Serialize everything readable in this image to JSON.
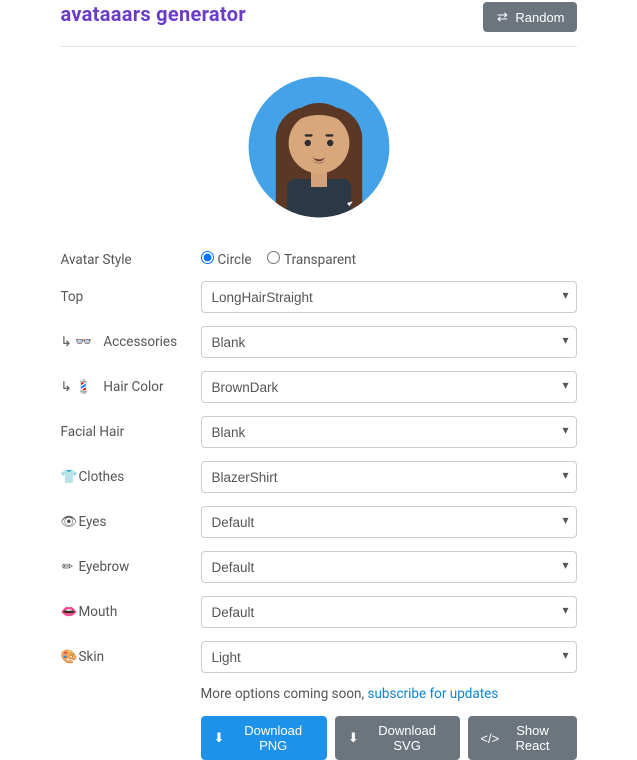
{
  "header": {
    "title": "avataaars generator",
    "random_btn": "Random"
  },
  "style_label": "Avatar Style",
  "style_options": {
    "circle": "Circle",
    "transparent": "Transparent"
  },
  "rows": {
    "top": {
      "label": "Top",
      "value": "LongHairStraight",
      "icon": ""
    },
    "accessories": {
      "label": "Accessories",
      "value": "Blank",
      "prefix": "↳ 👓"
    },
    "haircolor": {
      "label": "Hair Color",
      "value": "BrownDark",
      "prefix": "↳ 💈"
    },
    "facialhair": {
      "label": "Facial Hair",
      "value": "Blank",
      "icon": ""
    },
    "clothes": {
      "label": "Clothes",
      "value": "BlazerShirt",
      "icon": "👕"
    },
    "eyes": {
      "label": "Eyes",
      "value": "Default",
      "icon": "👁"
    },
    "eyebrow": {
      "label": "Eyebrow",
      "value": "Default",
      "icon": "✏"
    },
    "mouth": {
      "label": "Mouth",
      "value": "Default",
      "icon": "👄"
    },
    "skin": {
      "label": "Skin",
      "value": "Light",
      "icon": "🎨"
    }
  },
  "more_options": {
    "text": "More options coming soon, ",
    "link": "subscribe for updates"
  },
  "buttons": {
    "png": "Download PNG",
    "svg": "Download SVG",
    "react": "Show React"
  },
  "colors": {
    "accent": "#6a3cc8",
    "primary": "#1d92e8",
    "grey": "#6c757d"
  }
}
